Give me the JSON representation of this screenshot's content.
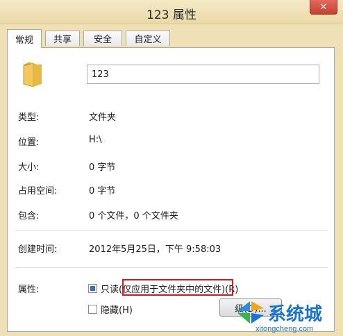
{
  "window": {
    "title": "123 属性",
    "close_label": "✕"
  },
  "tabs": [
    {
      "label": "常规",
      "active": true
    },
    {
      "label": "共享",
      "active": false
    },
    {
      "label": "安全",
      "active": false
    },
    {
      "label": "自定义",
      "active": false
    }
  ],
  "general": {
    "folder_name": "123",
    "rows": [
      {
        "label": "类型:",
        "value": "文件夹"
      },
      {
        "label": "位置:",
        "value": "H:\\"
      },
      {
        "label": "大小:",
        "value": "0 字节"
      },
      {
        "label": "占用空间:",
        "value": "0 字节"
      },
      {
        "label": "包含:",
        "value": "0 个文件，0 个文件夹"
      },
      {
        "label": "创建时间:",
        "value": "2012年5月25日，下午 9:58:03"
      }
    ],
    "attributes_label": "属性:",
    "readonly_label": "只读",
    "readonly_note": "(仅应用于文件夹中的文件)",
    "readonly_shortcut": "(R)",
    "readonly_state": "indeterminate",
    "hidden_label": "隐藏(H)",
    "hidden_checked": false,
    "advanced_button_label": "级(D)..."
  },
  "watermark": {
    "text": "系统城",
    "url": "xitongcheng.com"
  },
  "colors": {
    "titlebar": "#efe0b5",
    "highlight_box": "#e0141d",
    "watermark": "#1b73d1"
  },
  "icons": [
    "folder-icon",
    "close-icon",
    "windows-logo-icon"
  ]
}
